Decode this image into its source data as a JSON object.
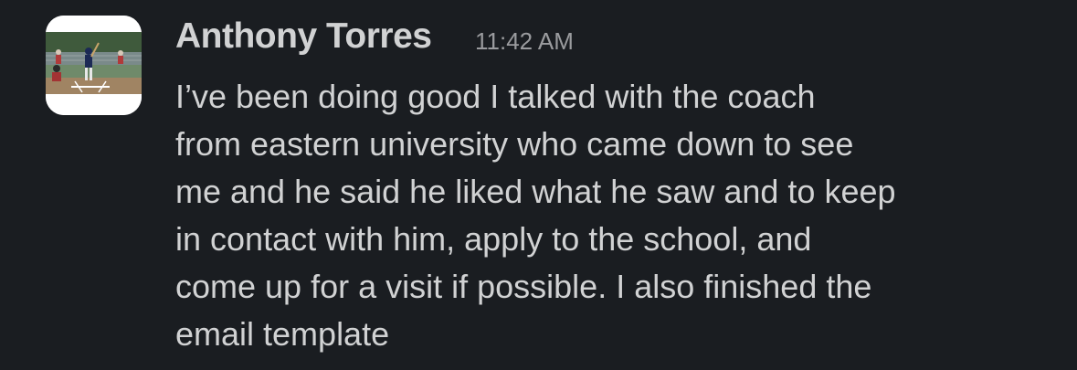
{
  "message": {
    "sender": "Anthony Torres",
    "timestamp": "11:42 AM",
    "avatar_icon": "baseball-batter-photo",
    "text_lines": [
      "I’ve been doing good I talked with the coach",
      "from eastern university who came down to see",
      "me and he said he liked what he saw and to keep",
      "in contact with him, apply to the school, and",
      "come up for a visit if possible. I also finished the",
      "email template"
    ]
  },
  "colors": {
    "background": "#1a1d21",
    "text": "#d1d2d3",
    "timestamp": "#9a9b9e"
  }
}
